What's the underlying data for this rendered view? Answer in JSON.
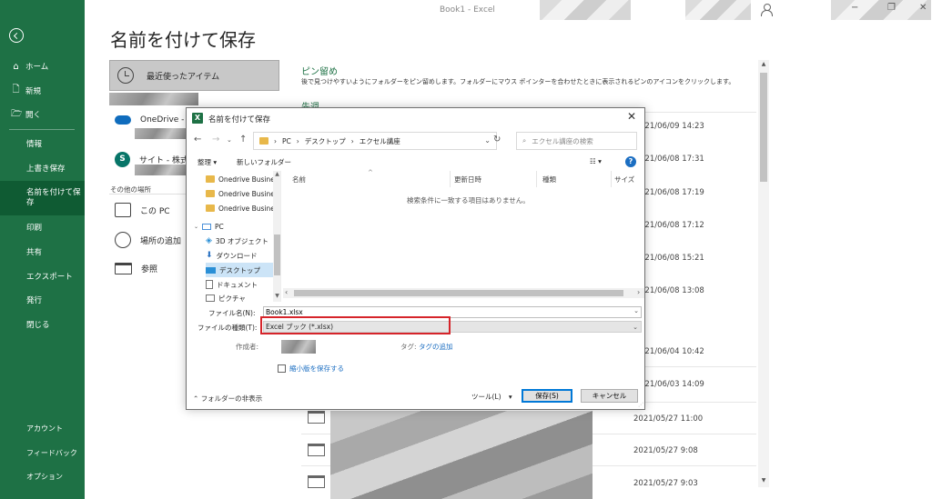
{
  "window": {
    "title": "Book1  -  Excel"
  },
  "sidebar": {
    "top_items": [
      {
        "label": "ホーム",
        "icon": "home-icon",
        "glyph": "⌂"
      },
      {
        "label": "新規",
        "icon": "new-document-icon",
        "glyph": "🗋"
      },
      {
        "label": "開く",
        "icon": "open-folder-icon",
        "glyph": "🗁"
      }
    ],
    "items": [
      "情報",
      "上書き保存",
      "名前を付けて保\n存",
      "印刷",
      "共有",
      "エクスポート",
      "発行",
      "閉じる"
    ],
    "active_index": 2,
    "bottom_items": [
      "アカウント",
      "フィードバック",
      "オプション"
    ]
  },
  "backstage": {
    "title": "名前を付けて保存",
    "recent_label": "最近使ったアイテム",
    "onedrive_label": "OneDrive -",
    "site_label": "サイト - 株式",
    "other_locations_label": "その他の場所",
    "this_pc_label": "この PC",
    "add_location_label": "場所の追加",
    "browse_label": "参照",
    "pinned_heading": "ピン留め",
    "pinned_description": "後で見つけやすいようにフォルダーをピン留めします。フォルダーにマウス ポインターを合わせたときに表示されるピンのアイコンをクリックします。",
    "this_week_heading": "先週",
    "dates": [
      "021/06/09 14:23",
      "021/06/08 17:31",
      "021/06/08 17:19",
      "021/06/08 17:12",
      "021/06/08 15:21",
      "021/06/08 13:08",
      "021/06/04 10:42",
      "021/06/03 14:09",
      "2021/05/27 11:00",
      "2021/05/27 9:08",
      "2021/05/27 9:03"
    ]
  },
  "dialog": {
    "title": "名前を付けて保存",
    "breadcrumb": [
      "PC",
      "デスクトップ",
      "エクセル講座"
    ],
    "search_placeholder": "エクセル講座の検索",
    "organize_label": "整理 ▾",
    "new_folder_label": "新しいフォルダー",
    "nav_items": [
      {
        "label": "Onedrive Busine",
        "icon": "folder-icon"
      },
      {
        "label": "Onedrive Busine",
        "icon": "folder-icon"
      },
      {
        "label": "Onedrive Busine",
        "icon": "folder-icon"
      },
      {
        "label": "PC",
        "icon": "pc-icon"
      },
      {
        "label": "3D オブジェクト",
        "icon": "3d-objects-icon"
      },
      {
        "label": "ダウンロード",
        "icon": "download-icon"
      },
      {
        "label": "デスクトップ",
        "icon": "desktop-icon"
      },
      {
        "label": "ドキュメント",
        "icon": "documents-icon"
      },
      {
        "label": "ピクチャ",
        "icon": "pictures-icon"
      }
    ],
    "selected_nav_index": 6,
    "columns": [
      "名前",
      "更新日時",
      "種類",
      "サイズ"
    ],
    "empty_message": "検索条件に一致する項目はありません。",
    "filename_label": "ファイル名(N):",
    "filename_value": "Book1.xlsx",
    "filetype_label": "ファイルの種類(T):",
    "filetype_value": "Excel ブック (*.xlsx)",
    "author_label": "作成者:",
    "tags_label": "タグ:",
    "tags_link": "タグの追加",
    "thumbnail_label": "縮小版を保存する",
    "hide_folders_label": "フォルダーの非表示",
    "tools_label": "ツール(L)",
    "save_label": "保存(S)",
    "cancel_label": "キャンセル"
  },
  "colors": {
    "accent": "#1e7145",
    "highlight": "#d6242a",
    "link": "#1b6ec2"
  }
}
